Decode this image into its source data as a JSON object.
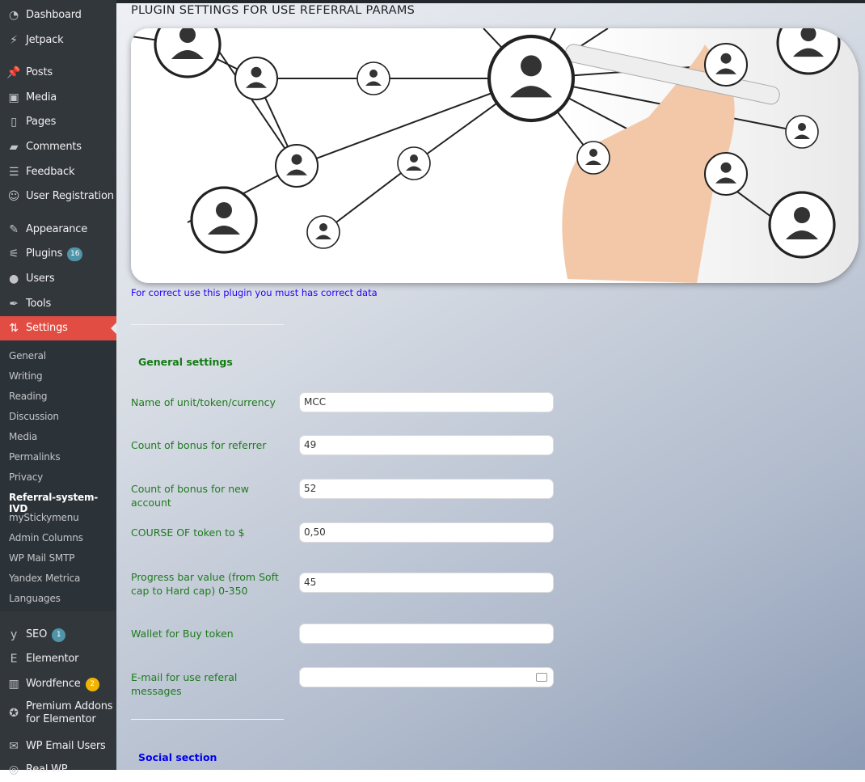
{
  "sidebar": {
    "items": [
      {
        "label": "Dashboard",
        "icon": "dashboard-icon"
      },
      {
        "label": "Jetpack",
        "icon": "jetpack-icon"
      },
      {
        "label": "Posts",
        "icon": "pin-icon"
      },
      {
        "label": "Media",
        "icon": "media-icon"
      },
      {
        "label": "Pages",
        "icon": "pages-icon"
      },
      {
        "label": "Comments",
        "icon": "comment-icon"
      },
      {
        "label": "Feedback",
        "icon": "feedback-icon"
      },
      {
        "label": "User Registration",
        "icon": "user-registration-icon"
      },
      {
        "label": "Appearance",
        "icon": "brush-icon"
      },
      {
        "label": "Plugins",
        "icon": "plug-icon",
        "badge": "16"
      },
      {
        "label": "Users",
        "icon": "users-icon"
      },
      {
        "label": "Tools",
        "icon": "wrench-icon"
      },
      {
        "label": "Settings",
        "icon": "settings-icon"
      },
      {
        "label": "SEO",
        "icon": "yoast-icon",
        "badge": "1"
      },
      {
        "label": "Elementor",
        "icon": "elementor-icon"
      },
      {
        "label": "Wordfence",
        "icon": "wordfence-icon",
        "badge": "2"
      },
      {
        "label": "Premium Addons for Elementor",
        "icon": "premium-addons-icon"
      },
      {
        "label": "WP Email Users",
        "icon": "envelope-icon"
      },
      {
        "label": "Real WP",
        "icon": "realwp-icon"
      }
    ],
    "submenu": [
      "General",
      "Writing",
      "Reading",
      "Discussion",
      "Media",
      "Permalinks",
      "Privacy",
      "Referral-system-IVD",
      "myStickymenu",
      "Admin Columns",
      "WP Mail SMTP",
      "Yandex Metrica",
      "Languages"
    ]
  },
  "main": {
    "title": "PLUGIN SETTINGS FOR USE REFERRAL PARAMS",
    "note": "For correct use this plugin you must has correct data",
    "general_heading": "General settings",
    "fields": [
      {
        "label": "Name of unit/token/currency",
        "value": "MCC"
      },
      {
        "label": "Count of bonus for referrer",
        "value": "49"
      },
      {
        "label": "Count of bonus for new account",
        "value": "52"
      },
      {
        "label": "COURSE OF token to $",
        "value": "0,50"
      },
      {
        "label": "Progress bar value (from Soft cap to Hard cap) 0-350",
        "value": "45"
      },
      {
        "label": "Wallet for Buy token",
        "value": ""
      },
      {
        "label": "E-mail for use referal messages",
        "value": ""
      }
    ],
    "social_heading": "Social section"
  },
  "colors": {
    "sidebar": "#32373c",
    "active": "#e14d43",
    "label": "#1f7a1f",
    "note": "#2200ff",
    "social": "#0000ee"
  }
}
